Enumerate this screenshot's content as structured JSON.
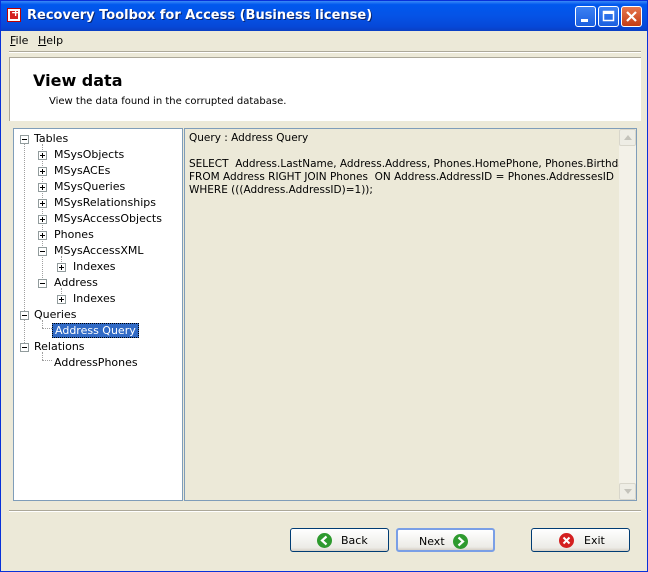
{
  "window": {
    "title": "Recovery Toolbox for Access (Business license)"
  },
  "menu": [
    {
      "label": "File",
      "accel": "F",
      "rest": "ile"
    },
    {
      "label": "Help",
      "accel": "H",
      "rest": "elp"
    }
  ],
  "header": {
    "title": "View data",
    "subtitle": "View the data found in the corrupted database."
  },
  "tree": {
    "tables_label": "Tables",
    "tables": [
      "MSysObjects",
      "MSysACEs",
      "MSysQueries",
      "MSysRelationships",
      "MSysAccessObjects",
      "Phones",
      "MSysAccessXML",
      "Indexes",
      "Address",
      "Indexes"
    ],
    "queries_label": "Queries",
    "query_item": "Address Query",
    "relations_label": "Relations",
    "relation_item": "AddressPhones"
  },
  "viewer": {
    "heading": "Query : Address Query",
    "sql_line1": "SELECT  Address.LastName, Address.Address, Phones.HomePhone, Phones.Birthdate",
    "sql_line2": "FROM Address RIGHT JOIN Phones  ON Address.AddressID = Phones.AddressesID",
    "sql_line3": "WHERE (((Address.AddressID)=1));"
  },
  "buttons": {
    "back": "Back",
    "next": "Next",
    "exit": "Exit"
  },
  "colors": {
    "titlebar": "#0553e6",
    "selection": "#316ac5",
    "back_icon": "#2e9a2e",
    "next_icon": "#2e9a2e",
    "exit_icon": "#d42020"
  }
}
